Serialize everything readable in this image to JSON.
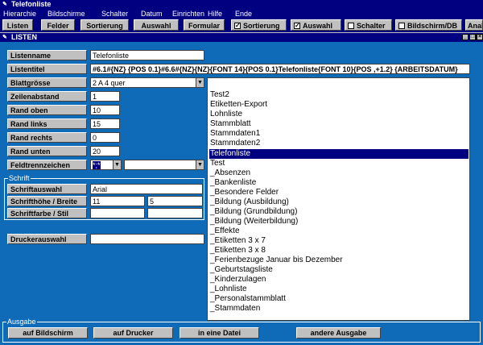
{
  "app": {
    "title": "Telefonliste"
  },
  "menu": [
    "Hierarchie",
    "Bildschirme",
    "Schalter",
    "Datum",
    "Einrichten",
    "Hilfe",
    "Ende"
  ],
  "toolbar": {
    "buttons": [
      "Listen",
      "Felder",
      "Sortierung",
      "Auswahl",
      "Formular"
    ],
    "checks": [
      {
        "label": "Sortierung",
        "checked": true
      },
      {
        "label": "Auswahl",
        "checked": true
      },
      {
        "label": "Schalter",
        "checked": false
      },
      {
        "label": "Bildschirm/DB",
        "checked": false
      }
    ],
    "truncated": "Anal"
  },
  "window": {
    "title": "LISTEN"
  },
  "form": {
    "listenname": {
      "label": "Listenname",
      "value": "Telefonliste"
    },
    "listentitel": {
      "label": "Listentitel",
      "value": "#6.1#{NZ} {POS 0.1}#6.6#{NZ}{NZ}{FONT 14}{POS 0.1}Telefonliste{FONT 10}{POS ,+1.2}     {ARBEITSDATUM}"
    },
    "blattgroesse": {
      "label": "Blattgrösse",
      "value": "2  A 4 quer"
    },
    "zeilenabstand": {
      "label": "Zeilenabstand",
      "value": "1"
    },
    "rand_oben": {
      "label": "Rand oben",
      "value": "10"
    },
    "rand_links": {
      "label": "Rand links",
      "value": "15"
    },
    "rand_rechts": {
      "label": "Rand rechts",
      "value": "0"
    },
    "rand_unten": {
      "label": "Rand unten",
      "value": "20"
    },
    "feldtrennzeichen": {
      "label": "Feldtrennzeichen",
      "value": "*;*",
      "second": ""
    }
  },
  "schrift": {
    "legend": "Schrift",
    "auswahl": {
      "label": "Schriftauswahl",
      "value": "Arial"
    },
    "hoehe": {
      "label": "Schrifthöhe / Breite",
      "value1": "11",
      "value2": "5"
    },
    "farbe": {
      "label": "Schriftfarbe / Stil",
      "value1": "",
      "value2": ""
    }
  },
  "drucker": {
    "label": "Druckerauswahl",
    "value": ""
  },
  "list": {
    "items": [
      "Test2",
      "Etiketten-Export",
      "Lohnliste",
      "Stammblatt",
      "Stammdaten1",
      "Stammdaten2",
      "Telefonliste",
      "Test",
      "_Absenzen",
      "_Bankenliste",
      "_Besondere Felder",
      "_Bildung (Ausbildung)",
      "_Bildung (Grundbildung)",
      "_Bildung (Weiterbildung)",
      "_Effekte",
      "_Etiketten 3 x 7",
      "_Etiketten 3 x 8",
      "_Ferienbezuge Januar bis Dezember",
      "_Geburtstagsliste",
      "_Kinderzulagen",
      "_Lohnliste",
      "_Personalstammblatt",
      "_Stammdaten"
    ],
    "selected": "Telefonliste"
  },
  "ausgabe": {
    "legend": "Ausgabe",
    "buttons": [
      "auf Bildschirm",
      "auf Drucker",
      "in eine Datei",
      "andere Ausgabe"
    ]
  },
  "colors": {
    "titlebar": "#000080",
    "window_bg": "#0f6bb8",
    "selection": "#000080"
  }
}
